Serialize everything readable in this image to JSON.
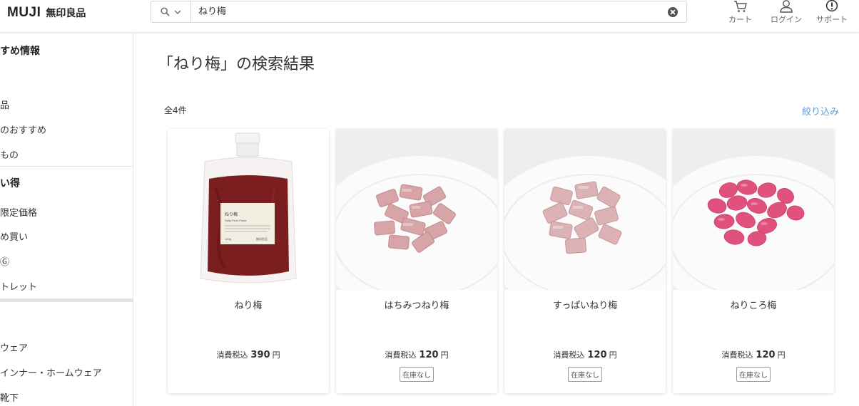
{
  "header": {
    "logo_en": "MUJI",
    "logo_jp": "無印良品",
    "search": {
      "value": "ねり梅"
    },
    "cart_label": "カート",
    "login_label": "ログイン",
    "support_label": "サポート"
  },
  "sidebar": {
    "heading_1": "すめ情報",
    "items_1": [
      "品",
      "のおすすめ",
      "もの"
    ],
    "heading_2": "い得",
    "items_2": [
      "限定価格",
      "め買い",
      "Ⓖ",
      "トレット"
    ],
    "items_3": [
      "ウェア",
      "インナー・ホームウェア",
      "靴下"
    ]
  },
  "main": {
    "title": "「ねり梅」の検索結果",
    "count": "全4件",
    "filter": "絞り込み"
  },
  "products": [
    {
      "name": "ねり梅",
      "price_prefix": "消費税込",
      "price": "390",
      "yen": "円",
      "stock": ""
    },
    {
      "name": "はちみつねり梅",
      "price_prefix": "消費税込",
      "price": "120",
      "yen": "円",
      "stock": "在庫なし"
    },
    {
      "name": "すっぱいねり梅",
      "price_prefix": "消費税込",
      "price": "120",
      "yen": "円",
      "stock": "在庫なし"
    },
    {
      "name": "ねりころ梅",
      "price_prefix": "消費税込",
      "price": "120",
      "yen": "円",
      "stock": "在庫なし"
    }
  ],
  "packet_label": {
    "title": "ねり梅",
    "subtitle": "Salty Plum Paste",
    "weight": "120g",
    "brand": "無印良品"
  },
  "icons": {
    "scope": "search-icon",
    "scope_toggle": "chevron-down-icon",
    "clear": "close-icon",
    "cart": "cart-icon",
    "login": "user-icon",
    "support": "exclamation-icon"
  },
  "colors": {
    "accent_link": "#5b9bd5",
    "plum_paste": "#7a1e20",
    "honey_plum": "#d7a5a8",
    "pink_plum": "#e0517e"
  }
}
